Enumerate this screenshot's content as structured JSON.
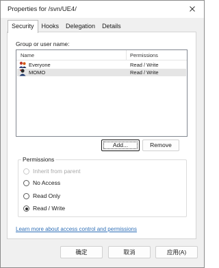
{
  "window": {
    "title": "Properties for /svn/UE4/"
  },
  "tabs": [
    {
      "label": "Security",
      "active": true
    },
    {
      "label": "Hooks",
      "active": false
    },
    {
      "label": "Delegation",
      "active": false
    },
    {
      "label": "Details",
      "active": false
    }
  ],
  "security": {
    "group_label": "Group or user name:",
    "columns": {
      "name": "Name",
      "permissions": "Permissions"
    },
    "rows": [
      {
        "name": "Everyone",
        "permissions": "Read / Write",
        "icon": "group-icon",
        "selected": false
      },
      {
        "name": "MOMO",
        "permissions": "Read / Write",
        "icon": "user-icon",
        "selected": true
      }
    ],
    "add_label": "Add...",
    "remove_label": "Remove"
  },
  "permissions": {
    "legend": "Permissions",
    "options": [
      {
        "label": "Inherit from parent",
        "checked": false,
        "disabled": true
      },
      {
        "label": "No Access",
        "checked": false,
        "disabled": false
      },
      {
        "label": "Read Only",
        "checked": false,
        "disabled": false
      },
      {
        "label": "Read / Write",
        "checked": true,
        "disabled": false
      }
    ]
  },
  "link_text": "Learn more about access control and permissions",
  "footer": {
    "ok_label": "确定",
    "cancel_label": "取消",
    "apply_label": "应用(A)"
  },
  "colors": {
    "link": "#2f6fb7",
    "selection": "#e5e5e5"
  }
}
